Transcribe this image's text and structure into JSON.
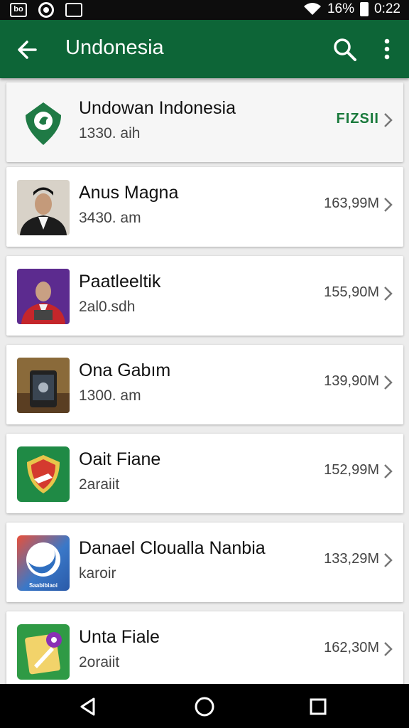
{
  "status_bar": {
    "notif_text": "bo",
    "signal_text": "16%",
    "time": "0:22"
  },
  "app_bar": {
    "title": "Undonesia"
  },
  "items": [
    {
      "name": "Undowan Indonesia",
      "sub": "1330. aih",
      "size": "FIZSII",
      "icon": "shield-logo-icon"
    },
    {
      "name": "Anus Magna",
      "sub": "3430. am",
      "size": "163,99M",
      "icon": "person-photo-icon"
    },
    {
      "name": "Paatleeltik",
      "sub": "2al0.sdh",
      "size": "155,90M",
      "icon": "person-photo-icon"
    },
    {
      "name": "Ona Gabım",
      "sub": "1300. am",
      "size": "139,90M",
      "icon": "device-photo-icon"
    },
    {
      "name": "Oait Fiane",
      "sub": "2araiit",
      "size": "152,99M",
      "icon": "shield-badge-icon"
    },
    {
      "name": "Danael Cloualla Nanbia",
      "sub": "karoir",
      "size": "133,29M",
      "icon": "wave-logo-icon"
    },
    {
      "name": "Unta Fiale",
      "sub": "2oraiit",
      "size": "162,30M",
      "icon": "notes-app-icon"
    }
  ],
  "thumb_label_6": "Saabibiaoi",
  "colors": {
    "app_bar": "#0d6537",
    "accent": "#1a7a3c"
  }
}
